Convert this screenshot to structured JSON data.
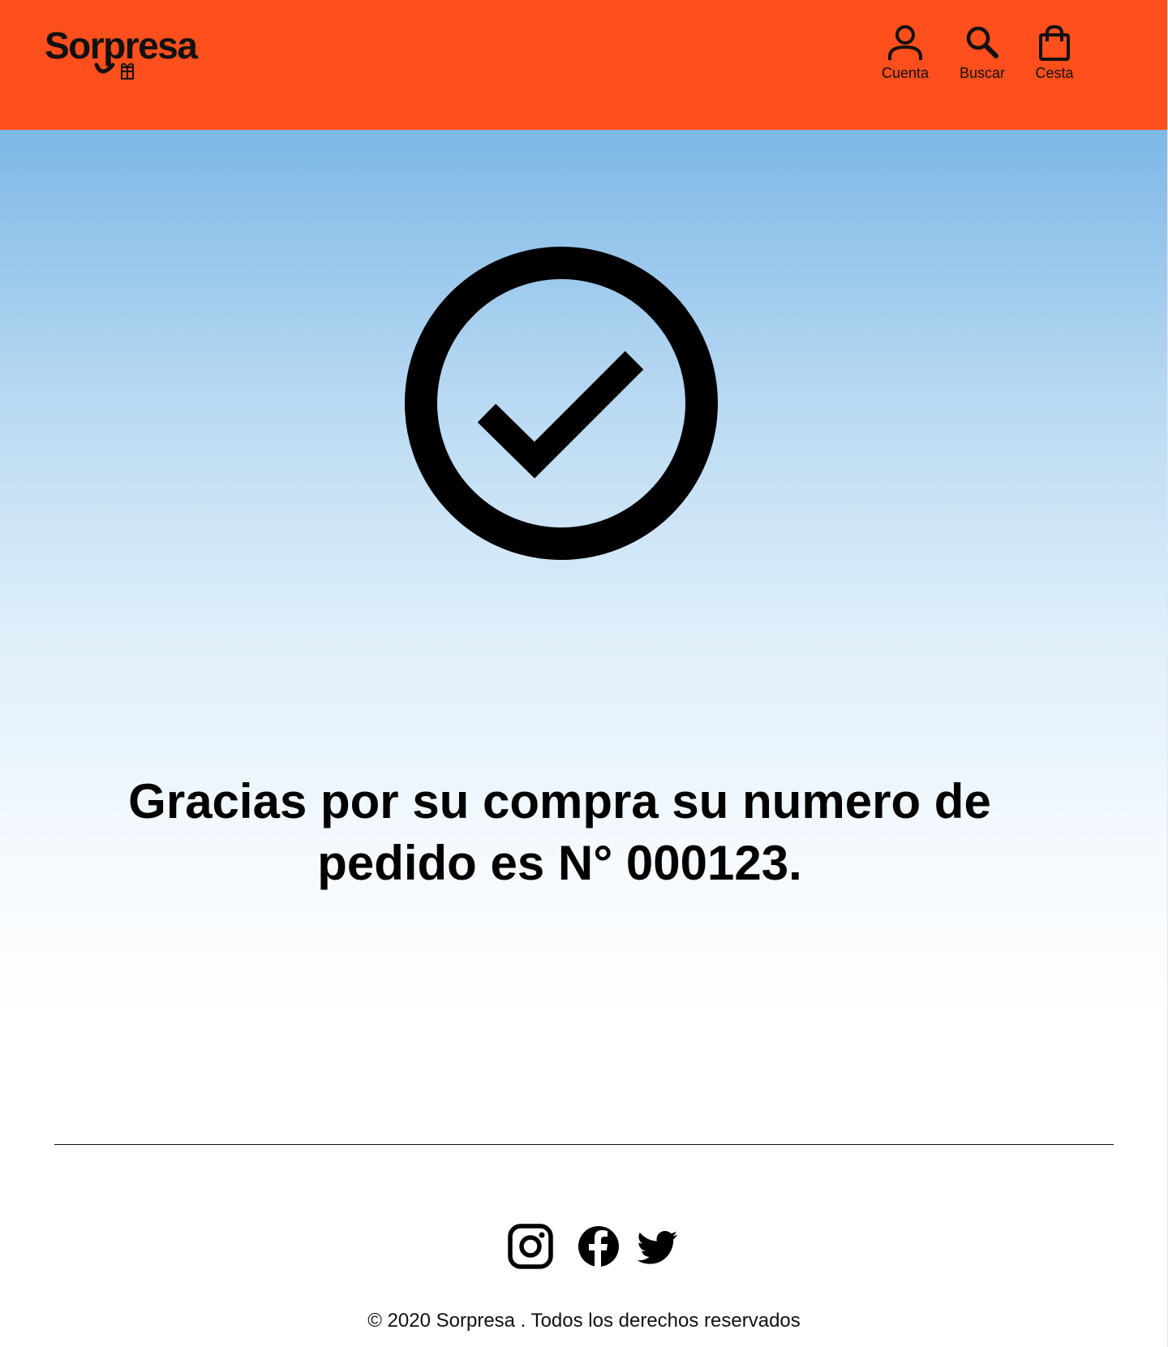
{
  "brand": {
    "name": "Sorpresa",
    "accent_color": "#FF4F1D"
  },
  "nav": {
    "account_label": "Cuenta",
    "search_label": "Buscar",
    "cart_label": "Cesta"
  },
  "main": {
    "status_icon": "check-circle-icon",
    "message": "Gracias por su compra su numero de pedido es N° 000123."
  },
  "footer": {
    "social": [
      "instagram-icon",
      "facebook-icon",
      "twitter-icon"
    ],
    "copyright": "© 2020 Sorpresa . Todos los derechos reservados"
  }
}
